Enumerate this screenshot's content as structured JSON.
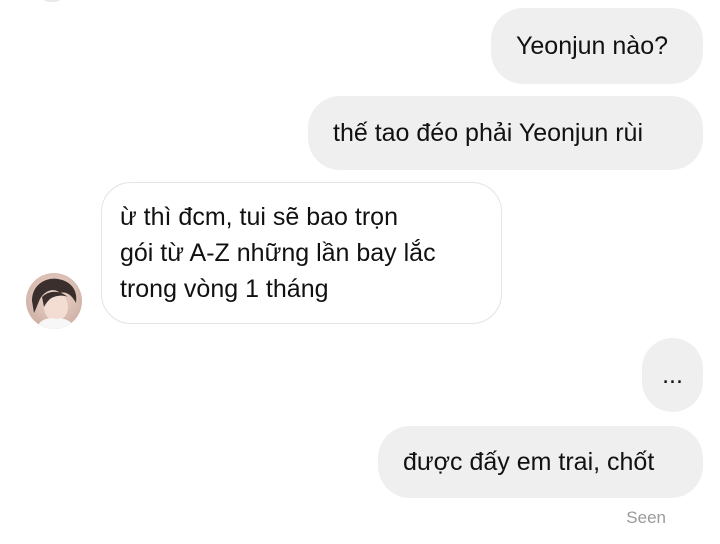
{
  "messages": {
    "m1": "Yeonjun nào?",
    "m2": "thế tao đéo phải Yeonjun rùi",
    "m3": {
      "lines": [
        "ừ thì đcm, tui sẽ bao trọn",
        "gói từ A-Z những lần bay lắc",
        "trong vòng 1 tháng"
      ]
    },
    "m4": "...",
    "m5": "được đấy em trai, chốt"
  },
  "status": {
    "seen_label": "Seen"
  },
  "colors": {
    "outgoing_bubble": "#efefef",
    "incoming_border": "#e4e4e4",
    "text": "#111111",
    "meta": "#9a9a9a"
  },
  "icons": {
    "avatar": "avatar-photo"
  }
}
